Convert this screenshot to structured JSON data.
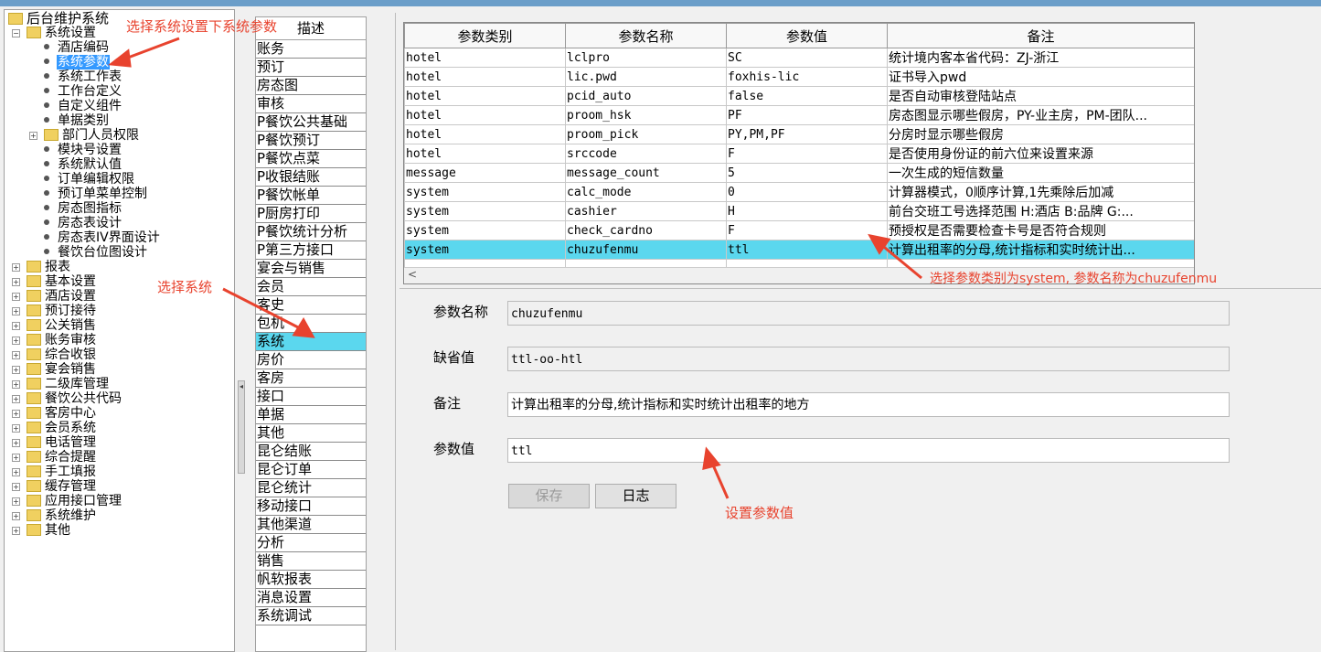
{
  "tree": {
    "root": "后台维护系统",
    "items": [
      {
        "label": "系统设置",
        "level": 1,
        "kind": "folder",
        "expanded": true
      },
      {
        "label": "酒店编码",
        "level": 2,
        "kind": "leaf"
      },
      {
        "label": "系统参数",
        "level": 2,
        "kind": "leaf",
        "selected": true
      },
      {
        "label": "系统工作表",
        "level": 2,
        "kind": "leaf"
      },
      {
        "label": "工作台定义",
        "level": 2,
        "kind": "leaf"
      },
      {
        "label": "自定义组件",
        "level": 2,
        "kind": "leaf"
      },
      {
        "label": "单据类别",
        "level": 2,
        "kind": "leaf"
      },
      {
        "label": "部门人员权限",
        "level": 2,
        "kind": "folder"
      },
      {
        "label": "模块号设置",
        "level": 2,
        "kind": "leaf"
      },
      {
        "label": "系统默认值",
        "level": 2,
        "kind": "leaf"
      },
      {
        "label": "订单编辑权限",
        "level": 2,
        "kind": "leaf"
      },
      {
        "label": "预订单菜单控制",
        "level": 2,
        "kind": "leaf"
      },
      {
        "label": "房态图指标",
        "level": 2,
        "kind": "leaf"
      },
      {
        "label": "房态表设计",
        "level": 2,
        "kind": "leaf"
      },
      {
        "label": "房态表IV界面设计",
        "level": 2,
        "kind": "leaf"
      },
      {
        "label": "餐饮台位图设计",
        "level": 2,
        "kind": "leaf"
      },
      {
        "label": "报表",
        "level": 1,
        "kind": "folder"
      },
      {
        "label": "基本设置",
        "level": 1,
        "kind": "folder"
      },
      {
        "label": "酒店设置",
        "level": 1,
        "kind": "folder"
      },
      {
        "label": "预订接待",
        "level": 1,
        "kind": "folder"
      },
      {
        "label": "公关销售",
        "level": 1,
        "kind": "folder"
      },
      {
        "label": "账务审核",
        "level": 1,
        "kind": "folder"
      },
      {
        "label": "综合收银",
        "level": 1,
        "kind": "folder"
      },
      {
        "label": "宴会销售",
        "level": 1,
        "kind": "folder"
      },
      {
        "label": "二级库管理",
        "level": 1,
        "kind": "folder"
      },
      {
        "label": "餐饮公共代码",
        "level": 1,
        "kind": "folder"
      },
      {
        "label": "客房中心",
        "level": 1,
        "kind": "folder"
      },
      {
        "label": "会员系统",
        "level": 1,
        "kind": "folder"
      },
      {
        "label": "电话管理",
        "level": 1,
        "kind": "folder"
      },
      {
        "label": "综合提醒",
        "level": 1,
        "kind": "folder"
      },
      {
        "label": "手工填报",
        "level": 1,
        "kind": "folder"
      },
      {
        "label": "缓存管理",
        "level": 1,
        "kind": "folder"
      },
      {
        "label": "应用接口管理",
        "level": 1,
        "kind": "folder"
      },
      {
        "label": "系统维护",
        "level": 1,
        "kind": "folder"
      },
      {
        "label": "其他",
        "level": 1,
        "kind": "folder"
      }
    ]
  },
  "desc": {
    "header": "描述",
    "items": [
      "账务",
      "预订",
      "房态图",
      "审核",
      "P餐饮公共基础",
      "P餐饮预订",
      "P餐饮点菜",
      "P收银结账",
      "P餐饮帐单",
      "P厨房打印",
      "P餐饮统计分析",
      "P第三方接口",
      "宴会与销售",
      "会员",
      "客史",
      "包机",
      "系统",
      "房价",
      "客房",
      "接口",
      "单据",
      "其他",
      "昆仑结账",
      "昆仑订单",
      "昆仑统计",
      "移动接口",
      "其他渠道",
      "分析",
      "销售",
      "帆软报表",
      "消息设置",
      "系统调试"
    ],
    "selected_index": 16
  },
  "grid": {
    "columns": [
      "参数类别",
      "参数名称",
      "参数值",
      "备注"
    ],
    "rows": [
      [
        "hotel",
        "lclpro",
        "SC",
        "统计境内客本省代码：ZJ-浙江"
      ],
      [
        "hotel",
        "lic.pwd",
        "foxhis-lic",
        "证书导入pwd"
      ],
      [
        "hotel",
        "pcid_auto",
        "false",
        "是否自动审核登陆站点"
      ],
      [
        "hotel",
        "proom_hsk",
        "PF",
        "房态图显示哪些假房，PY-业主房，PM-团队..."
      ],
      [
        "hotel",
        "proom_pick",
        "PY,PM,PF",
        "分房时显示哪些假房"
      ],
      [
        "hotel",
        "srccode",
        "F",
        "是否使用身份证的前六位来设置来源"
      ],
      [
        "message",
        "message_count",
        "5",
        "一次生成的短信数量"
      ],
      [
        "system",
        "calc_mode",
        "0",
        "计算器模式，0顺序计算,1先乘除后加减"
      ],
      [
        "system",
        "cashier",
        "H",
        "前台交班工号选择范围 H:酒店  B:品牌 G:..."
      ],
      [
        "system",
        "check_cardno",
        "F",
        "预授权是否需要检查卡号是否符合规则"
      ],
      [
        "system",
        "chuzufenmu",
        "ttl",
        "计算出租率的分母,统计指标和实时统计出..."
      ]
    ],
    "selected_index": 10,
    "scroll_left": "<"
  },
  "form": {
    "name_label": "参数名称",
    "name_value": "chuzufenmu",
    "default_label": "缺省值",
    "default_value": "ttl-oo-htl",
    "remark_label": "备注",
    "remark_value": "计算出租率的分母,统计指标和实时统计出租率的地方",
    "value_label": "参数值",
    "value_value": "ttl",
    "save_label": "保存",
    "log_label": "日志"
  },
  "annotations": {
    "a1": "选择系统设置下系统参数",
    "a2": "选择系统",
    "a3": "选择参数类别为system, 参数名称为chuzufenmu",
    "a4": "设置参数值"
  },
  "colors": {
    "selection": "#5bd7ee",
    "tree_selection": "#3399ff",
    "annotation": "#e8432e"
  }
}
